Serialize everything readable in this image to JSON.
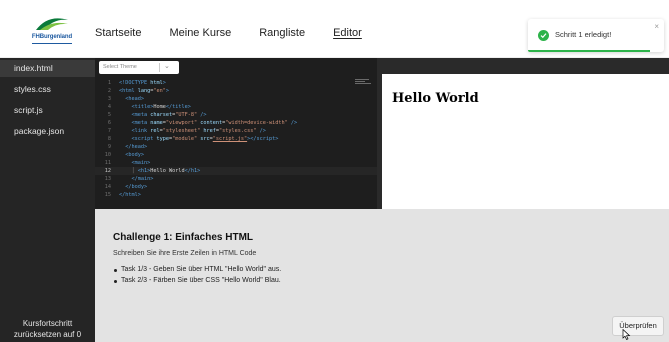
{
  "brand": {
    "name": "FH Burgenland",
    "logo_text": "FHBurgenland"
  },
  "nav": {
    "items": [
      {
        "label": "Startseite",
        "active": false
      },
      {
        "label": "Meine Kurse",
        "active": false
      },
      {
        "label": "Rangliste",
        "active": false
      },
      {
        "label": "Editor",
        "active": true
      }
    ]
  },
  "toast": {
    "message": "Schritt 1 erledigt!",
    "close": "×",
    "progress": 0.9,
    "accent": "#2db34a"
  },
  "files": {
    "items": [
      {
        "name": "index.html",
        "active": true
      },
      {
        "name": "styles.css",
        "active": false
      },
      {
        "name": "script.js",
        "active": false
      },
      {
        "name": "package.json",
        "active": false
      }
    ],
    "reset_label_line1": "Kursfortschritt",
    "reset_label_line2": "zurücksetzen auf 0"
  },
  "editor": {
    "theme_placeholder": "Select Theme",
    "current_line": 12,
    "lines": [
      {
        "n": "1",
        "html": "<span class='t'>&lt;!DOCTYPE</span> <span class='a'>html</span><span class='t'>&gt;</span>"
      },
      {
        "n": "2",
        "html": "<span class='t'>&lt;html</span> <span class='a'>lang</span><span class='x'>=</span><span class='s'>\"en\"</span><span class='t'>&gt;</span>"
      },
      {
        "n": "3",
        "html": "  <span class='t'>&lt;head&gt;</span>"
      },
      {
        "n": "4",
        "html": "    <span class='t'>&lt;title&gt;</span><span class='x'>Home</span><span class='t'>&lt;/title&gt;</span>"
      },
      {
        "n": "5",
        "html": "    <span class='t'>&lt;meta</span> <span class='a'>charset</span><span class='x'>=</span><span class='s'>\"UTF-8\"</span> <span class='t'>/&gt;</span>"
      },
      {
        "n": "6",
        "html": "    <span class='t'>&lt;meta</span> <span class='a'>name</span><span class='x'>=</span><span class='s'>\"viewport\"</span> <span class='a'>content</span><span class='x'>=</span><span class='s'>\"width=device-width\"</span> <span class='t'>/&gt;</span>"
      },
      {
        "n": "7",
        "html": "    <span class='t'>&lt;link</span> <span class='a'>rel</span><span class='x'>=</span><span class='s'>\"stylesheet\"</span> <span class='a'>href</span><span class='x'>=</span><span class='s'>\"styles.css\"</span> <span class='t'>/&gt;</span>"
      },
      {
        "n": "8",
        "html": "    <span class='t'>&lt;script</span> <span class='a'>type</span><span class='x'>=</span><span class='s'>\"module\"</span> <span class='a'>src</span><span class='x'>=</span><span class='s u'>\"script.js\"</span><span class='t'>&gt;&lt;/script&gt;</span>"
      },
      {
        "n": "9",
        "html": "  <span class='t'>&lt;/head&gt;</span>"
      },
      {
        "n": "10",
        "html": "  <span class='t'>&lt;body&gt;</span>"
      },
      {
        "n": "11",
        "html": "    <span class='t'>&lt;main&gt;</span>"
      },
      {
        "n": "12",
        "html": "    <span class='g'>│</span> <span class='t'>&lt;h1&gt;</span><span class='x'>Hello World</span><span class='t'>&lt;/h1&gt;</span>"
      },
      {
        "n": "13",
        "html": "    <span class='t'>&lt;/main&gt;</span>"
      },
      {
        "n": "14",
        "html": "  <span class='t'>&lt;/body&gt;</span>"
      },
      {
        "n": "15",
        "html": "<span class='t'>&lt;/html&gt;</span>"
      }
    ]
  },
  "preview": {
    "heading": "Hello World"
  },
  "challenge": {
    "title": "Challenge 1: Einfaches HTML",
    "description": "Schreiben Sie ihre Erste Zeilen in HTML Code",
    "tasks": [
      "Task 1/3 - Geben Sie über HTML \"Hello World\" aus.",
      "Task 2/3 - Färben Sie über CSS \"Hello World\" Blau."
    ],
    "check_label": "Überprüfen"
  }
}
